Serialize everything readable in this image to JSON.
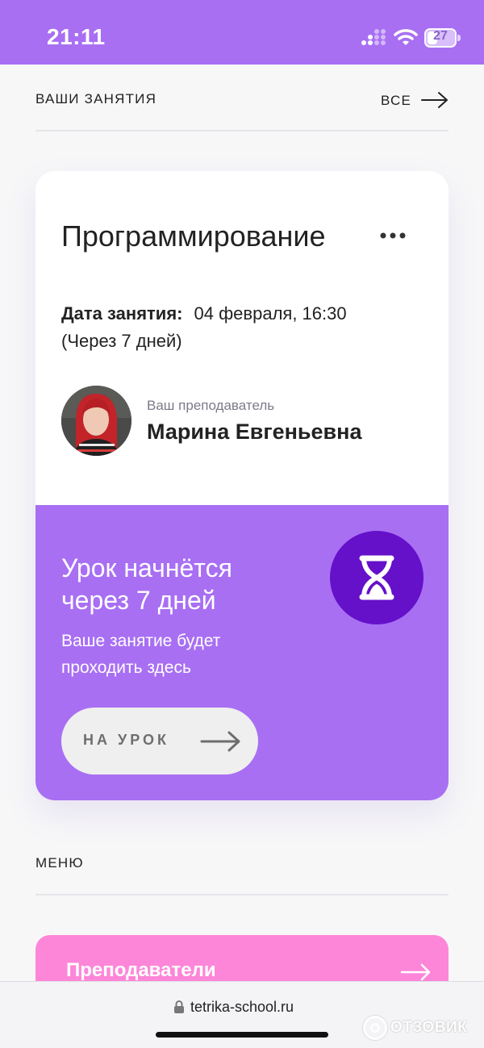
{
  "status_bar": {
    "time": "21:11",
    "battery": "27",
    "background_color": "#a86ff3"
  },
  "lessons_section": {
    "title": "ВАШИ ЗАНЯТИЯ",
    "all_link": "ВСЕ"
  },
  "lesson_card": {
    "subject": "Программирование",
    "date_label": "Дата занятия:",
    "date_value": "04 февраля, 16:30",
    "date_relative": "(Через 7 дней)",
    "teacher_caption": "Ваш преподаватель",
    "teacher_name": "Марина Евгеньевна",
    "banner": {
      "title": "Урок начнётся через 7 дней",
      "subtitle": "Ваше занятие будет проходить здесь",
      "button_label": "НА УРОК",
      "background_color": "#a86ff3",
      "badge_color": "#6510c9",
      "icon": "hourglass-icon"
    }
  },
  "menu_section": {
    "title": "МЕНЮ",
    "items": [
      {
        "label": "Преподаватели",
        "color": "#fe86d9"
      }
    ]
  },
  "browser": {
    "url": "tetrika-school.ru"
  },
  "watermark": {
    "text": "ОТЗОВИК"
  }
}
